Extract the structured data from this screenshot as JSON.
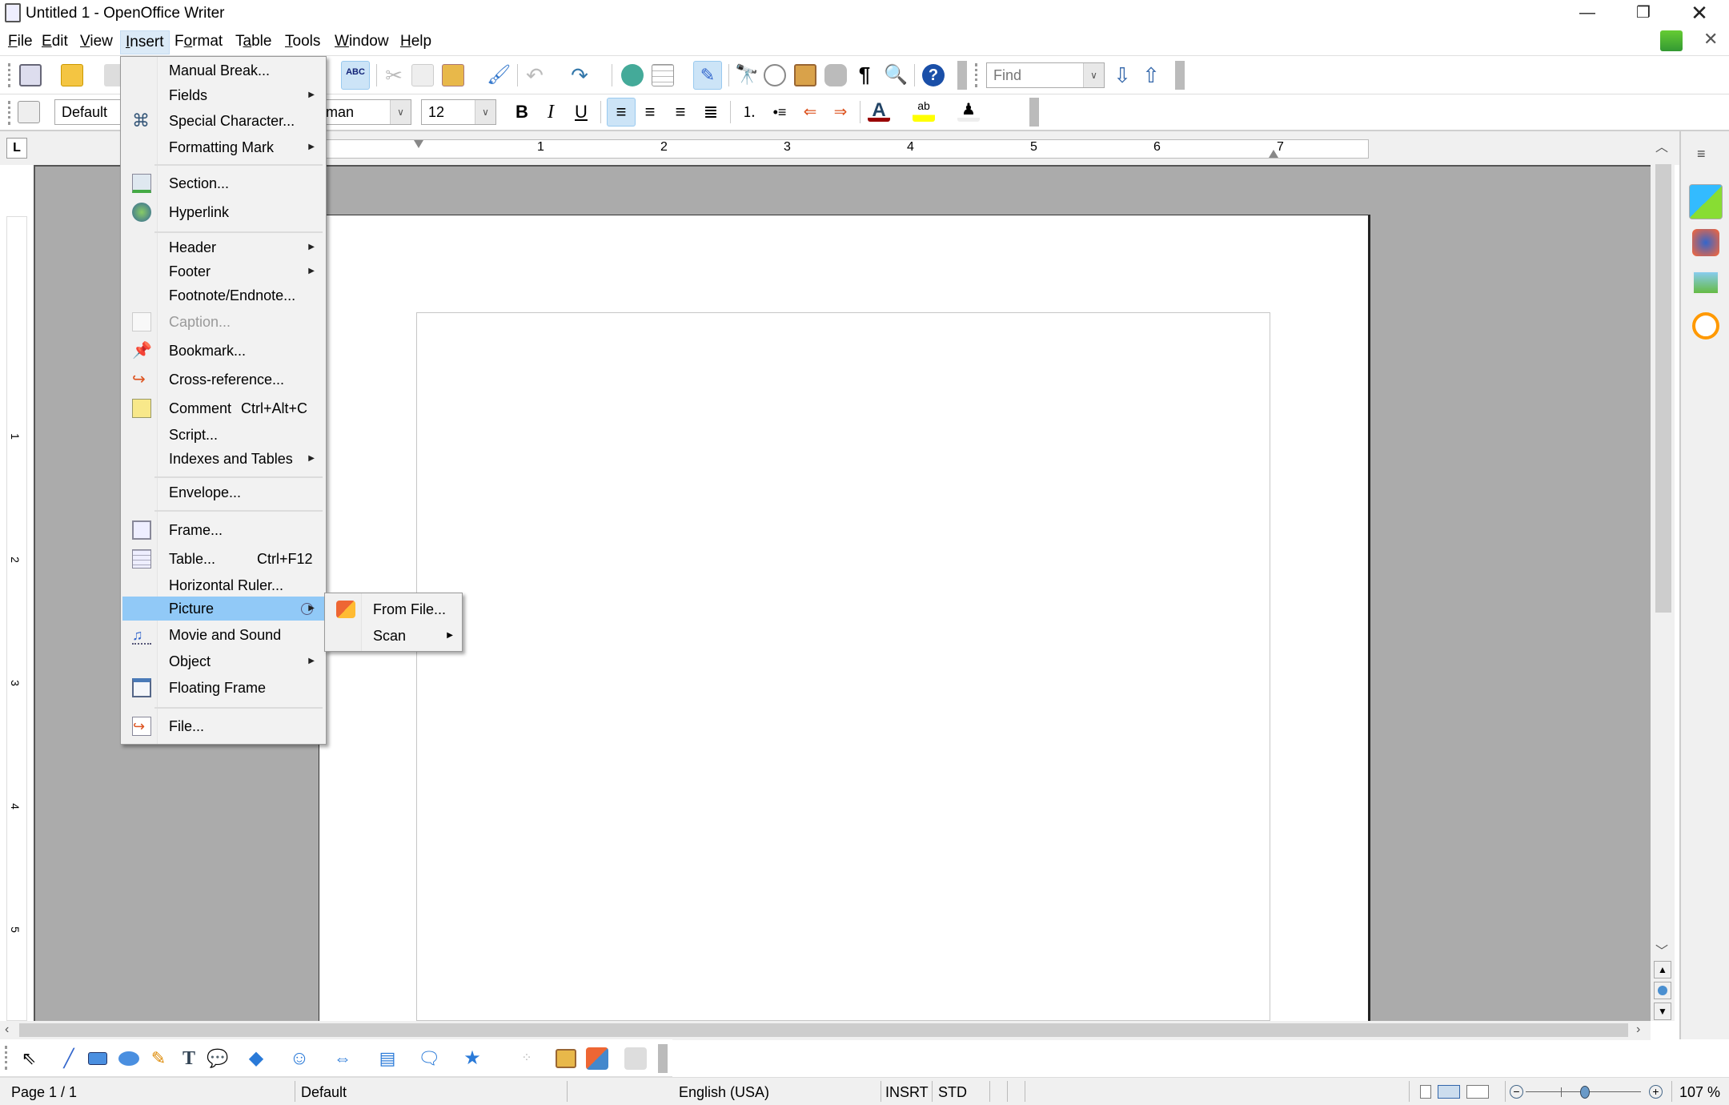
{
  "window": {
    "title": "Untitled 1 - OpenOffice Writer",
    "icon": "writer-doc-icon"
  },
  "menubar": [
    {
      "label": "File",
      "u": "F",
      "rest": "ile"
    },
    {
      "label": "Edit",
      "u": "E",
      "rest": "dit"
    },
    {
      "label": "View",
      "u": "V",
      "rest": "iew"
    },
    {
      "label": "Insert",
      "u": "I",
      "rest": "nsert",
      "active": true
    },
    {
      "label": "Format",
      "pre": "F",
      "u": "o",
      "rest": "rmat"
    },
    {
      "label": "Table",
      "pre": "T",
      "u": "a",
      "rest": "ble"
    },
    {
      "label": "Tools",
      "u": "T",
      "rest": "ools"
    },
    {
      "label": "Window",
      "u": "W",
      "rest": "indow"
    },
    {
      "label": "Help",
      "u": "H",
      "rest": "elp"
    }
  ],
  "toolbar": {
    "paragraph_style": "Default",
    "font_name": "Times New Roman",
    "font_name_visible": "man",
    "font_size": "12",
    "find_placeholder": "Find",
    "bold": "B",
    "italic": "I",
    "underline": "U"
  },
  "insert_menu": {
    "items": [
      {
        "label": "Manual Break...",
        "icon": null,
        "submenu": false
      },
      {
        "label": "Fields",
        "icon": null,
        "submenu": true
      },
      {
        "label": "Special Character...",
        "icon": "special-character-icon",
        "submenu": false
      },
      {
        "label": "Formatting Mark",
        "icon": null,
        "submenu": true
      },
      {
        "separator": true
      },
      {
        "label": "Section...",
        "icon": "section-icon",
        "submenu": false
      },
      {
        "label": "Hyperlink",
        "icon": "hyperlink-icon",
        "submenu": false
      },
      {
        "separator": true
      },
      {
        "label": "Header",
        "icon": null,
        "submenu": true
      },
      {
        "label": "Footer",
        "icon": null,
        "submenu": true
      },
      {
        "label": "Footnote/Endnote...",
        "icon": null,
        "submenu": false
      },
      {
        "label": "Caption...",
        "icon": "caption-icon",
        "submenu": false,
        "disabled": true
      },
      {
        "label": "Bookmark...",
        "icon": "bookmark-icon",
        "submenu": false
      },
      {
        "label": "Cross-reference...",
        "icon": "cross-reference-icon",
        "submenu": false
      },
      {
        "label": "Comment",
        "shortcut": "Ctrl+Alt+C",
        "icon": "comment-icon",
        "submenu": false
      },
      {
        "label": "Script...",
        "icon": null,
        "submenu": false
      },
      {
        "label": "Indexes and Tables",
        "icon": null,
        "submenu": true
      },
      {
        "separator": true
      },
      {
        "label": "Envelope...",
        "icon": null,
        "submenu": false
      },
      {
        "separator": true
      },
      {
        "label": "Frame...",
        "icon": "frame-icon",
        "submenu": false
      },
      {
        "label": "Table...",
        "shortcut": "Ctrl+F12",
        "icon": "table-icon",
        "submenu": false
      },
      {
        "label": "Horizontal Ruler...",
        "icon": null,
        "submenu": false
      },
      {
        "label": "Picture",
        "icon": null,
        "submenu": true,
        "highlighted": true
      },
      {
        "label": "Movie and Sound",
        "icon": "movie-sound-icon",
        "submenu": false
      },
      {
        "label": "Object",
        "icon": null,
        "submenu": true
      },
      {
        "label": "Floating Frame",
        "icon": "floating-frame-icon",
        "submenu": false
      },
      {
        "separator": true
      },
      {
        "label": "File...",
        "icon": "insert-file-icon",
        "submenu": false
      }
    ]
  },
  "picture_submenu": {
    "items": [
      {
        "label": "From File...",
        "icon": "picture-from-file-icon",
        "submenu": false
      },
      {
        "label": "Scan",
        "icon": null,
        "submenu": true
      }
    ]
  },
  "ruler": {
    "h_labels": [
      "1",
      "2",
      "3",
      "4",
      "5",
      "6",
      "7"
    ],
    "v_labels": [
      "1",
      "2",
      "3",
      "4",
      "5"
    ]
  },
  "statusbar": {
    "page": "Page 1 / 1",
    "page_style": "Default",
    "language": "English (USA)",
    "insert_mode": "INSRT",
    "selection_mode": "STD",
    "zoom": "107 %",
    "zoom_level_percent": 107
  },
  "colors": {
    "menu_highlight": "#91c9f7",
    "menu_active": "#dbeaf7",
    "doc_bg": "#ababab"
  }
}
